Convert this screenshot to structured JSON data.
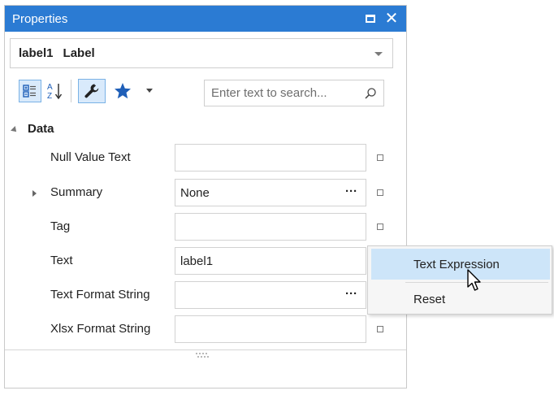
{
  "window": {
    "title": "Properties"
  },
  "object_selector": {
    "name": "label1",
    "type": "Label"
  },
  "toolbar": {
    "search_placeholder": "Enter text to search..."
  },
  "category": {
    "label": "Data"
  },
  "properties": [
    {
      "label": "Null Value Text",
      "value": "",
      "has_ellipsis": false,
      "expandable": false
    },
    {
      "label": "Summary",
      "value": "None",
      "has_ellipsis": true,
      "expandable": true
    },
    {
      "label": "Tag",
      "value": "",
      "has_ellipsis": false,
      "expandable": false
    },
    {
      "label": "Text",
      "value": "label1",
      "has_ellipsis": false,
      "expandable": false
    },
    {
      "label": "Text Format String",
      "value": "",
      "has_ellipsis": true,
      "expandable": false
    },
    {
      "label": "Xlsx Format String",
      "value": "",
      "has_ellipsis": false,
      "expandable": false
    }
  ],
  "ellipsis_glyph": "···",
  "context_menu": {
    "items": [
      {
        "label": "Text Expression",
        "highlighted": true
      },
      {
        "label": "Reset",
        "highlighted": false
      }
    ]
  },
  "colors": {
    "titlebar": "#2b7bd3",
    "highlight": "#cde5f9",
    "accent_icon": "#1f5fb8"
  },
  "icons": {
    "categorized": "categorized-icon",
    "alphabetical": "sort-alphabetical-icon",
    "properties": "wrench-icon",
    "favorites": "star-icon",
    "search": "search-icon"
  }
}
